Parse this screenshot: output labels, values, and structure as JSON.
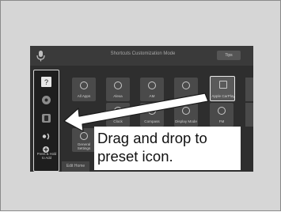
{
  "screen": {
    "title": "Shortcuts Customization Mode",
    "tips_button": "Tips"
  },
  "sidebar": {
    "hold_label_line1": "Press & Hold",
    "hold_label_line2": "to Add",
    "icons": [
      "help-icon",
      "navigation-icon",
      "phone-icon",
      "audio-icon",
      "add-icon"
    ]
  },
  "tiles": [
    {
      "label": "All Apps"
    },
    {
      "label": "Alexa"
    },
    {
      "label": "AM"
    },
    {
      "label": ""
    },
    {
      "label": "Apple CarPlay"
    },
    {
      "label": "General Settings"
    },
    {
      "label": "Clock"
    },
    {
      "label": "Compass"
    },
    {
      "label": "Display Mode"
    },
    {
      "label": "FM"
    }
  ],
  "bottom_bar": {
    "edit_home": "Edit Home"
  },
  "callout": {
    "line1": "Drag and drop to",
    "line2": "preset icon."
  }
}
